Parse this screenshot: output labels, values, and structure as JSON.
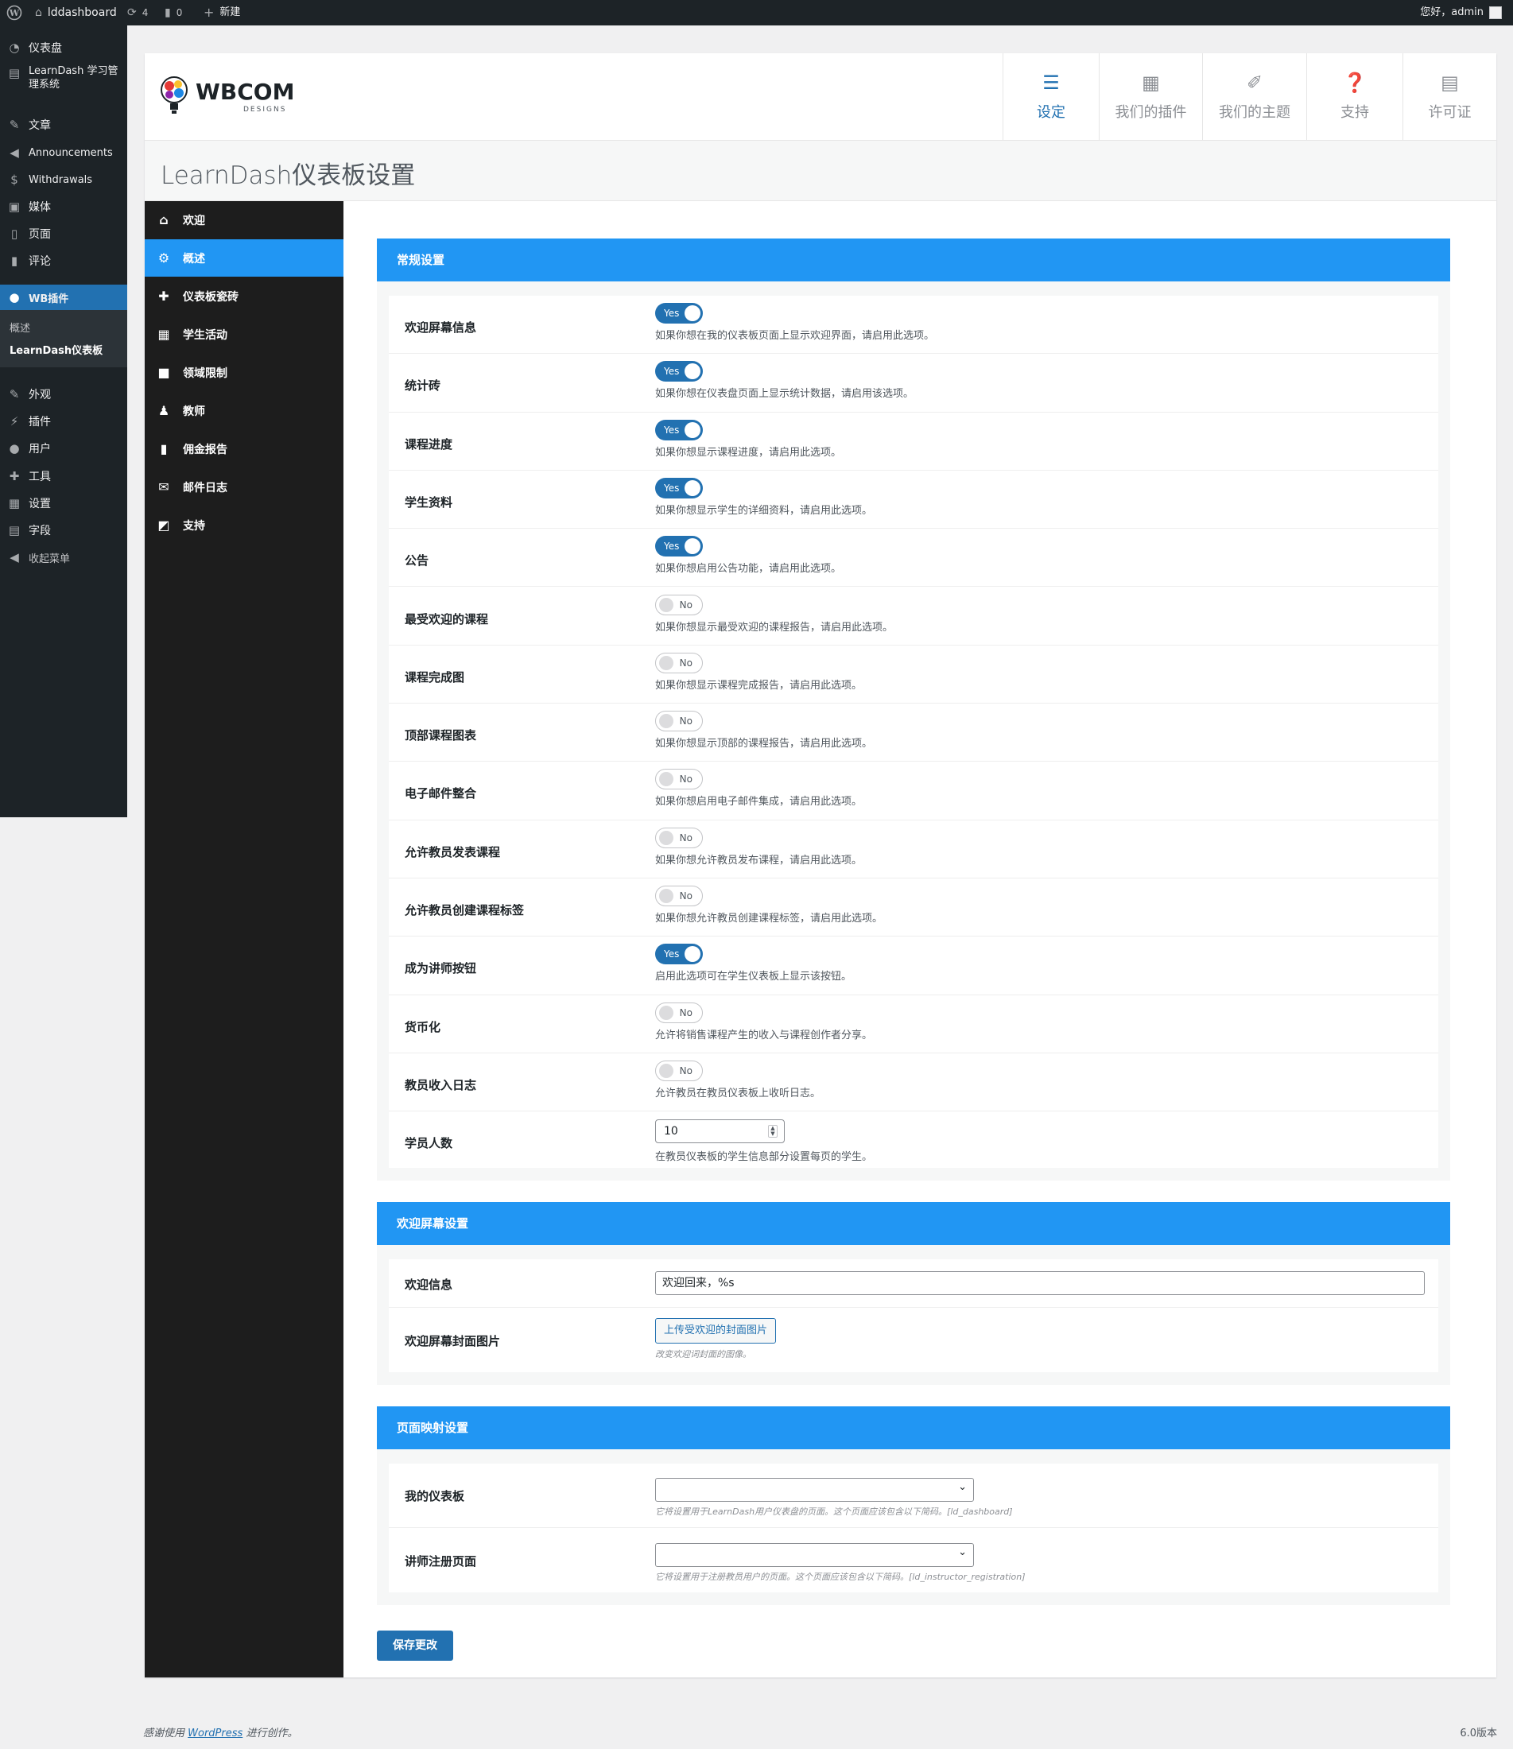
{
  "adminbar": {
    "site": "lddashboard",
    "updates": "4",
    "comments": "0",
    "new": "新建",
    "greeting": "您好，admin"
  },
  "menu": {
    "items": [
      "仪表盘",
      "LearnDash 学习管理系统",
      "文章",
      "Announcements",
      "Withdrawals",
      "媒体",
      "页面",
      "评论",
      "WB插件"
    ],
    "sub": [
      "概述",
      "LearnDash仪表板"
    ],
    "items2": [
      "外观",
      "插件",
      "用户",
      "工具",
      "设置",
      "字段",
      "收起菜单"
    ]
  },
  "header": {
    "logo_main": "WBCOM",
    "logo_sub": "DESIGNS",
    "tabs": [
      "设定",
      "我们的插件",
      "我们的主题",
      "支持",
      "许可证"
    ]
  },
  "page_title": "LearnDash仪表板设置",
  "nav": [
    "欢迎",
    "概述",
    "仪表板瓷砖",
    "学生活动",
    "领域限制",
    "教师",
    "佣金报告",
    "邮件日志",
    "支持"
  ],
  "general": {
    "title": "常规设置",
    "rows": [
      {
        "label": "欢迎屏幕信息",
        "state": "Yes",
        "desc": "如果你想在我的仪表板页面上显示欢迎界面，请启用此选项。"
      },
      {
        "label": "统计砖",
        "state": "Yes",
        "desc": "如果你想在仪表盘页面上显示统计数据，请启用该选项。"
      },
      {
        "label": "课程进度",
        "state": "Yes",
        "desc": "如果你想显示课程进度，请启用此选项。"
      },
      {
        "label": "学生资料",
        "state": "Yes",
        "desc": "如果你想显示学生的详细资料，请启用此选项。"
      },
      {
        "label": "公告",
        "state": "Yes",
        "desc": "如果你想启用公告功能，请启用此选项。"
      },
      {
        "label": "最受欢迎的课程",
        "state": "No",
        "desc": "如果你想显示最受欢迎的课程报告，请启用此选项。"
      },
      {
        "label": "课程完成图",
        "state": "No",
        "desc": "如果你想显示课程完成报告，请启用此选项。"
      },
      {
        "label": "顶部课程图表",
        "state": "No",
        "desc": "如果你想显示顶部的课程报告，请启用此选项。"
      },
      {
        "label": "电子邮件整合",
        "state": "No",
        "desc": "如果你想启用电子邮件集成，请启用此选项。"
      },
      {
        "label": "允许教员发表课程",
        "state": "No",
        "desc": "如果你想允许教员发布课程，请启用此选项。"
      },
      {
        "label": "允许教员创建课程标签",
        "state": "No",
        "desc": "如果你想允许教员创建课程标签，请启用此选项。"
      },
      {
        "label": "成为讲师按钮",
        "state": "Yes",
        "desc": "启用此选项可在学生仪表板上显示该按钮。"
      },
      {
        "label": "货币化",
        "state": "No",
        "desc": "允许将销售课程产生的收入与课程创作者分享。"
      },
      {
        "label": "教员收入日志",
        "state": "No",
        "desc": "允许教员在教员仪表板上收听日志。"
      }
    ],
    "students": {
      "label": "学员人数",
      "value": "10",
      "desc": "在教员仪表板的学生信息部分设置每页的学生。"
    }
  },
  "welcome": {
    "title": "欢迎屏幕设置",
    "msg_label": "欢迎信息",
    "msg_value": "欢迎回来，%s",
    "img_label": "欢迎屏幕封面图片",
    "img_button": "上传受欢迎的封面图片",
    "img_desc": "改变欢迎词封面的图像。"
  },
  "mapping": {
    "title": "页面映射设置",
    "dash_label": "我的仪表板",
    "dash_desc": "它将设置用于LearnDash用户仪表盘的页面。这个页面应该包含以下简码。[ld_dashboard]",
    "reg_label": "讲师注册页面",
    "reg_desc": "它将设置用于注册教员用户的页面。这个页面应该包含以下简码。[ld_instructor_registration]"
  },
  "save": "保存更改",
  "footer": {
    "pre": "感谢使用",
    "link": "WordPress",
    "post": "进行创作。",
    "version": "6.0版本"
  }
}
